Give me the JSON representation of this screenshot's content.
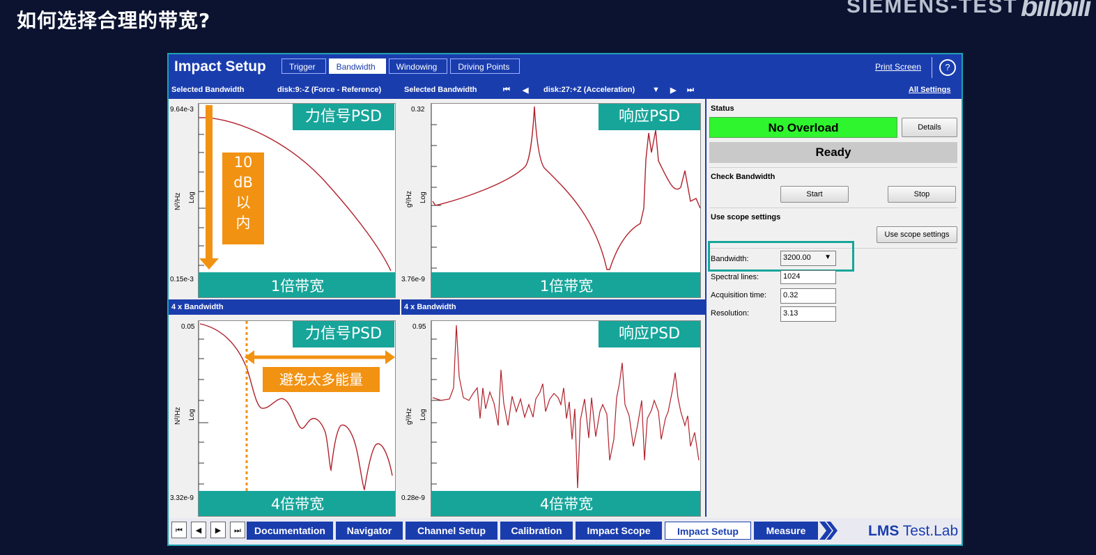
{
  "slide": {
    "title": "如何选择合理的带宽?",
    "brand": "SIEMENS-TEST",
    "watermark": "bilibili"
  },
  "app": {
    "title": "Impact Setup",
    "steps": [
      "Trigger",
      "Bandwidth",
      "Windowing",
      "Driving Points"
    ],
    "active_step": "Bandwidth",
    "print_screen": "Print Screen",
    "help": "?",
    "all_settings": "All Settings"
  },
  "selection": {
    "label_left": "Selected Bandwidth",
    "ref_channel": "disk:9:-Z (Force - Reference)",
    "label_right": "Selected Bandwidth",
    "resp_channel": "disk:27:+Z (Acceleration)",
    "first": "⏮",
    "prev": "◀",
    "next": "▶",
    "last": "⏭",
    "dropdown": "▼"
  },
  "plots": {
    "top_left": {
      "ymax": "9.64e-3",
      "ymin": "0.15e-3",
      "unit": "N²/Hz",
      "scale": "Log",
      "tag": "力信号PSD",
      "caption": "1倍带宽"
    },
    "top_right": {
      "ymax": "0.32",
      "ymin": "3.76e-9",
      "unit": "g²/Hz",
      "scale": "Log",
      "tag": "响应PSD",
      "caption": "1倍带宽"
    },
    "bottom_left": {
      "ymax": "0.05",
      "ymin": "3.32e-9",
      "unit": "N²/Hz",
      "scale": "Log",
      "tag": "力信号PSD",
      "caption": "4倍带宽"
    },
    "bottom_right": {
      "ymax": "0.95",
      "ymin": "0.28e-9",
      "unit": "g²/Hz",
      "scale": "Log",
      "tag": "响应PSD",
      "caption": "4倍带宽"
    }
  },
  "sections": {
    "four_x_left": "4 x Bandwidth",
    "four_x_right": "4 x Bandwidth"
  },
  "annotations": {
    "range": [
      "10",
      "dB",
      "以",
      "内"
    ],
    "avoid": "避免太多能量"
  },
  "panel": {
    "status_label": "Status",
    "overload": "No Overload",
    "details": "Details",
    "ready": "Ready",
    "check_label": "Check Bandwidth",
    "start": "Start",
    "stop": "Stop",
    "scope_label": "Use scope settings",
    "scope_button": "Use scope settings",
    "bandwidth_label": "Bandwidth:",
    "bandwidth_value": "3200.00",
    "lines_label": "Spectral lines:",
    "lines_value": "1024",
    "acq_label": "Acquisition time:",
    "acq_value": "0.32",
    "res_label": "Resolution:",
    "res_value": "3.13"
  },
  "workflow": {
    "nav": [
      "⏮",
      "◀",
      "▶",
      "⏭"
    ],
    "steps": [
      "Documentation",
      "Navigator",
      "Channel Setup",
      "Calibration",
      "Impact Scope",
      "Impact Setup",
      "Measure"
    ],
    "active": "Impact Setup",
    "logo_bold": "LMS",
    "logo_rest": " Test.Lab"
  },
  "colors": {
    "app_blue": "#1a3dae",
    "teal": "#17a59a",
    "curve": "#b0202a",
    "overload_green": "#2ef52e",
    "annotation_orange": "#f29212"
  }
}
